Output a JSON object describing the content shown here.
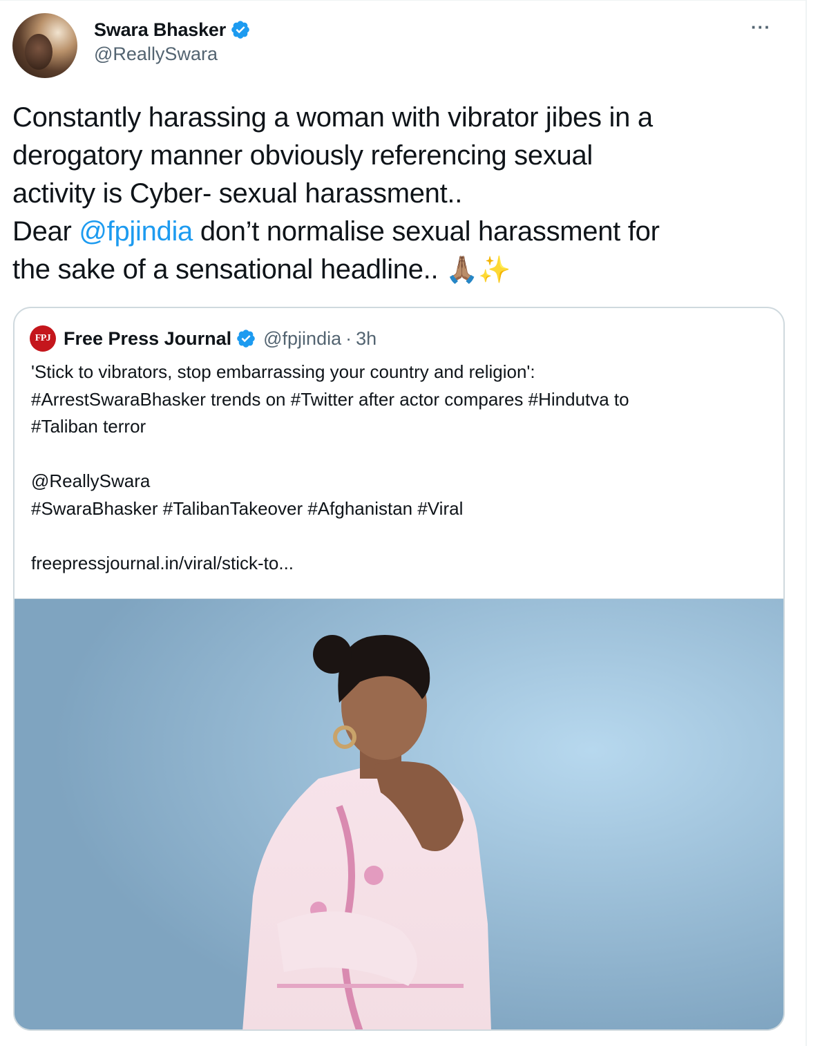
{
  "author": {
    "display_name": "Swara Bhasker",
    "handle": "@ReallySwara",
    "verified": true
  },
  "menu": {
    "more_label": "···"
  },
  "tweet": {
    "lines": [
      "Constantly harassing a woman with vibrator jibes in a",
      "derogatory manner obviously referencing sexual",
      "activity is Cyber- sexual harassment.."
    ],
    "line4_prefix": "Dear ",
    "line4_mention": "@fpjindia",
    "line4_suffix": " don’t normalise sexual harassment for",
    "line5_text": "the sake of a sensational headline.. ",
    "line5_emoji": "🙏🏽✨"
  },
  "quoted": {
    "logo_text": "FPJ",
    "display_name": "Free Press Journal",
    "verified": true,
    "handle": "@fpjindia",
    "separator": "·",
    "time": "3h",
    "lines": [
      "'Stick to vibrators, stop embarrassing your country and religion':",
      "#ArrestSwaraBhasker trends on #Twitter after actor compares #Hindutva to",
      "#Taliban terror",
      "",
      "@ReallySwara",
      "#SwaraBhasker #TalibanTakeover #Afghanistan #Viral",
      "",
      "freepressjournal.in/viral/stick-to..."
    ]
  },
  "colors": {
    "link": "#1d9bf0",
    "text": "#0f1419",
    "secondary": "#536471",
    "border": "#cfd9de",
    "verified": "#1d9bf0",
    "fpj_red": "#c4161c"
  },
  "icons": {
    "verified": "verified-badge-icon",
    "more": "more-horizontal-icon"
  }
}
